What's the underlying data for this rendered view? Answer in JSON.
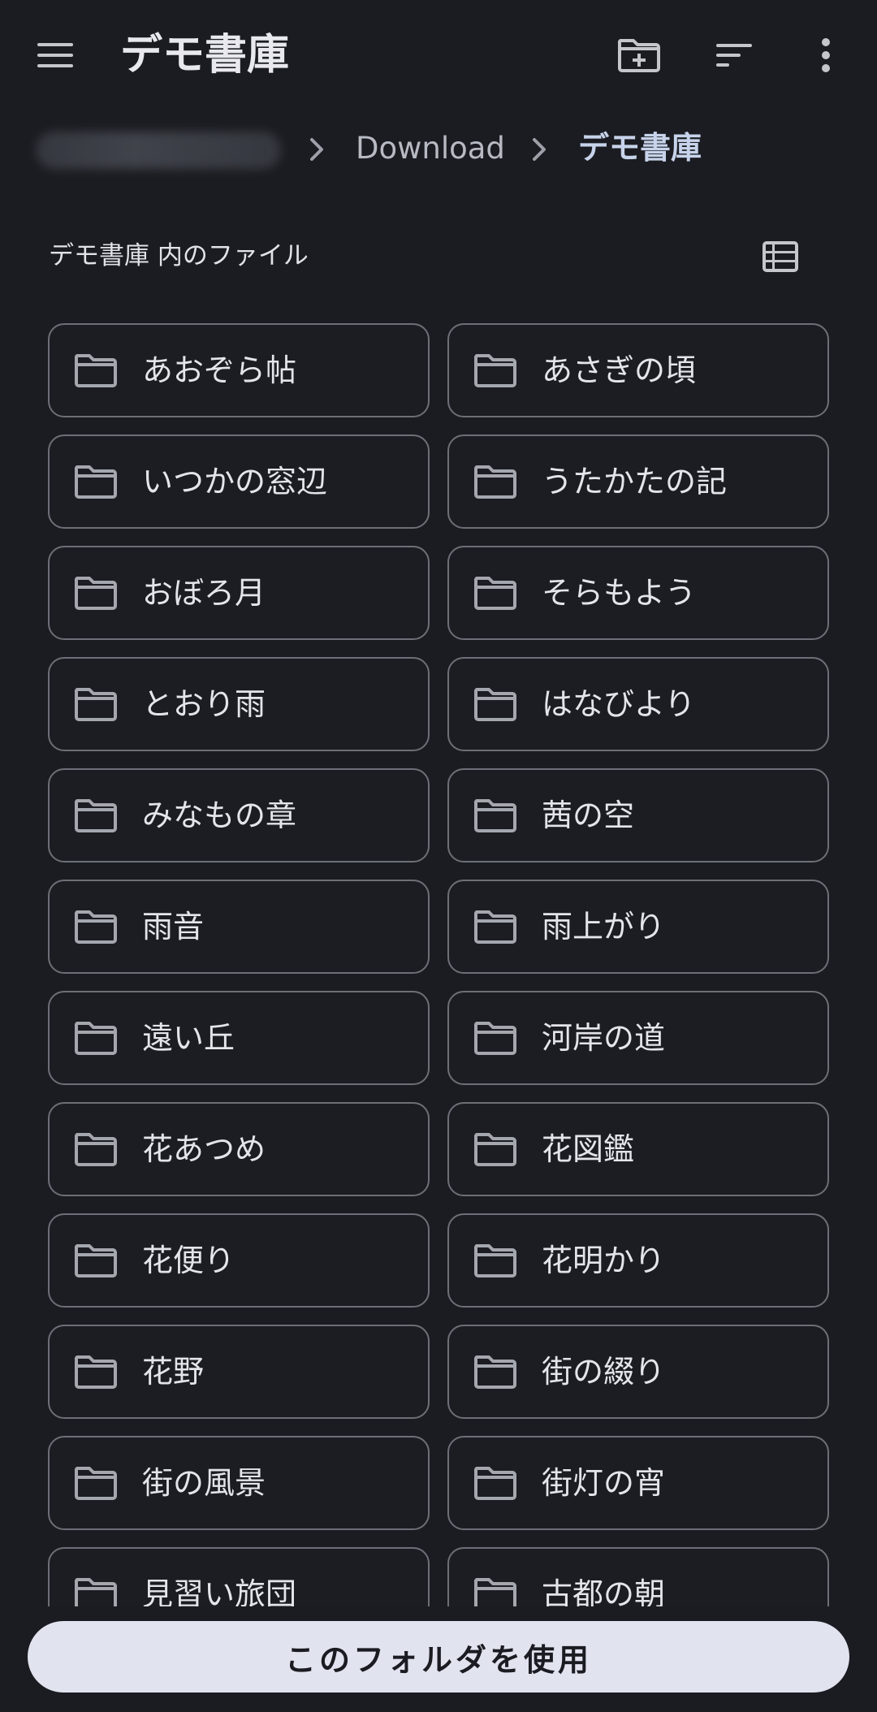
{
  "topbar": {
    "title": "デモ書庫",
    "menu_icon": "menu-icon",
    "new_folder_icon": "create-new-folder-icon",
    "sort_icon": "sort-icon",
    "more_icon": "more-vert-icon"
  },
  "breadcrumb": {
    "root_label": "",
    "items": [
      {
        "label": "Download"
      },
      {
        "label": "デモ書庫"
      }
    ]
  },
  "section": {
    "title": "デモ書庫 内のファイル",
    "view_toggle_icon": "list-view-icon"
  },
  "folders": [
    "あおぞら帖",
    "あさぎの頃",
    "いつかの窓辺",
    "うたかたの記",
    "おぼろ月",
    "そらもよう",
    "とおり雨",
    "はなびより",
    "みなもの章",
    "茜の空",
    "雨音",
    "雨上がり",
    "遠い丘",
    "河岸の道",
    "花あつめ",
    "花図鑑",
    "花便り",
    "花明かり",
    "花野",
    "街の綴り",
    "街の風景",
    "街灯の宵",
    "見習い旅団",
    "古都の朝"
  ],
  "bottom": {
    "use_folder_label": "このフォルダを使用"
  },
  "colors": {
    "background": "#1a1c21",
    "card_border": "#6c6f77",
    "button_bg": "#e1e3ef",
    "breadcrumb_current": "#c7d3ea"
  }
}
